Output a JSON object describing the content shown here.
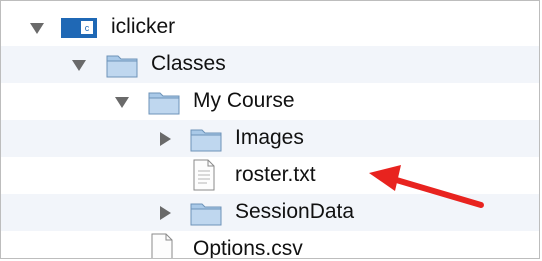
{
  "tree": {
    "items": [
      {
        "label": "iclicker",
        "icon": "app-folder-icon",
        "expanded": true
      },
      {
        "label": "Classes",
        "icon": "folder-icon",
        "expanded": true
      },
      {
        "label": "My Course",
        "icon": "folder-icon",
        "expanded": true
      },
      {
        "label": "Images",
        "icon": "folder-icon",
        "expanded": false
      },
      {
        "label": "roster.txt",
        "icon": "text-file-icon"
      },
      {
        "label": "SessionData",
        "icon": "folder-icon",
        "expanded": false
      },
      {
        "label": "Options.csv",
        "icon": "csv-file-icon"
      }
    ]
  },
  "colors": {
    "row_stripe": "#f2f5fa",
    "folder_fill": "#a9c9e8",
    "arrow": "#e8231f",
    "disclosure": "#6a6a6a"
  },
  "annotation": {
    "icon": "red-arrow-icon",
    "points_to": "roster.txt"
  }
}
